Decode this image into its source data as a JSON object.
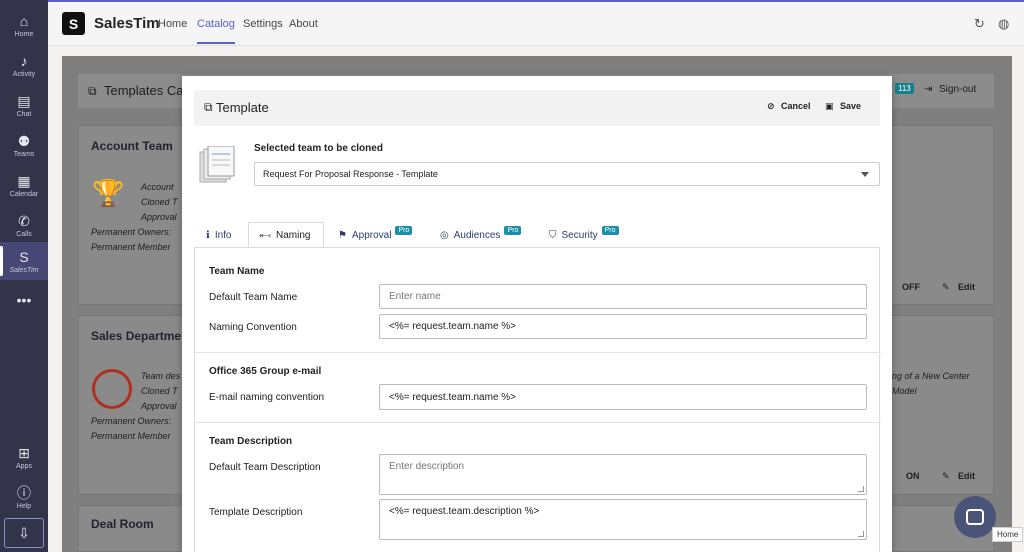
{
  "rail": {
    "items": [
      {
        "label": "Home",
        "icon": "home-icon",
        "glyph": "⌂"
      },
      {
        "label": "Activity",
        "icon": "bell-icon",
        "glyph": "🔔"
      },
      {
        "label": "Chat",
        "icon": "chat-icon",
        "glyph": "▤"
      },
      {
        "label": "Teams",
        "icon": "teams-icon",
        "glyph": "⚉"
      },
      {
        "label": "Calendar",
        "icon": "calendar-icon",
        "glyph": "▦"
      },
      {
        "label": "Calls",
        "icon": "phone-icon",
        "glyph": "✆"
      },
      {
        "label": "SalesTim",
        "icon": "salestim-icon",
        "glyph": "S"
      },
      {
        "label": "",
        "icon": "more-icon",
        "glyph": "•••"
      },
      {
        "label": "Apps",
        "icon": "apps-icon",
        "glyph": "⊞"
      },
      {
        "label": "Help",
        "icon": "help-icon",
        "glyph": "?"
      }
    ]
  },
  "topbar": {
    "logo": "S",
    "app_name": "SalesTim",
    "tabs": [
      "Home",
      "Catalog",
      "Settings",
      "About"
    ],
    "active_tab": "Catalog"
  },
  "background": {
    "header_title": "Templates Cat",
    "badge": "113",
    "signout": "Sign-out",
    "cards": [
      {
        "title": "Account Team",
        "lines": [
          "Account",
          "Cloned T",
          "Approval"
        ],
        "owners": "Permanent Owners:",
        "members": "Permanent Member",
        "toggle": "OFF",
        "edit": "Edit"
      },
      {
        "title": "Sales Departme",
        "lines": [
          "Team des",
          "Cloned T",
          "Approval"
        ],
        "owners": "Permanent Owners:",
        "members": "Permanent Member",
        "right1": "ng of a New Center",
        "right2": "Model",
        "toggle": "ON",
        "edit": "Edit"
      },
      {
        "title": "Deal Room"
      }
    ]
  },
  "modal": {
    "title": "Template",
    "cancel": "Cancel",
    "save": "Save",
    "selected_label": "Selected team to be cloned",
    "selected_value": "Request For Proposal Response - Template",
    "tabs": [
      {
        "label": "Info",
        "icon": "info-icon",
        "pro": ""
      },
      {
        "label": "Naming",
        "icon": "tag-icon",
        "pro": ""
      },
      {
        "label": "Approval",
        "icon": "flag-icon",
        "pro": "Pro"
      },
      {
        "label": "Audiences",
        "icon": "target-icon",
        "pro": "Pro"
      },
      {
        "label": "Security",
        "icon": "shield-icon",
        "pro": "Pro"
      }
    ],
    "active_tab": "Naming",
    "sections": {
      "team_name": "Team Name",
      "default_team_name_label": "Default Team Name",
      "default_team_name_placeholder": "Enter name",
      "naming_convention_label": "Naming Convention",
      "naming_convention_value": "<%= request.team.name %>",
      "group_email": "Office 365 Group e-mail",
      "email_convention_label": "E-mail naming convention",
      "email_convention_value": "<%= request.team.name %>",
      "team_description": "Team Description",
      "default_desc_label": "Default Team Description",
      "default_desc_placeholder": "Enter description",
      "template_desc_label": "Template Description",
      "template_desc_value": "<%= request.team.description %>"
    }
  },
  "tooltip": "Home"
}
